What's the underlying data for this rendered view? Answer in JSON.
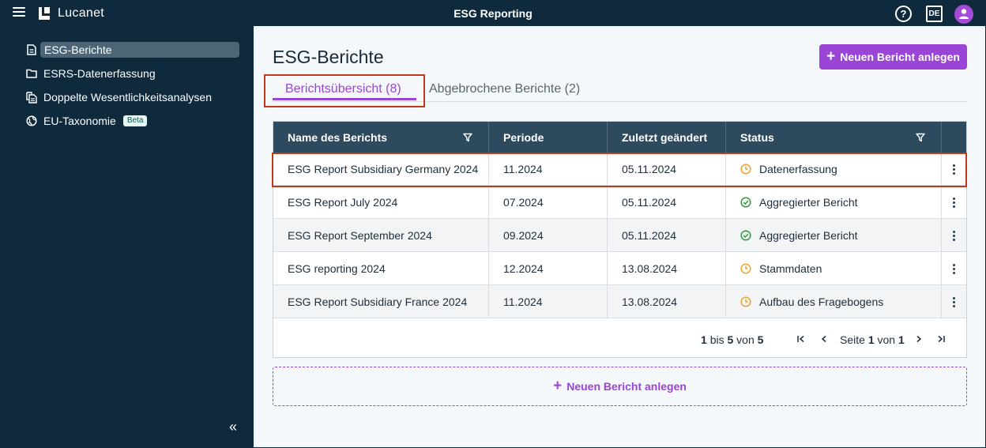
{
  "topbar": {
    "brand": "Lucanet",
    "app_title": "ESG Reporting",
    "help_label": "?",
    "language": "DE"
  },
  "sidebar": {
    "items": [
      {
        "label": "ESG-Berichte",
        "icon": "document-icon",
        "active": true
      },
      {
        "label": "ESRS-Datenerfassung",
        "icon": "folder-icon"
      },
      {
        "label": "Doppelte Wesentlichkeitsanalysen",
        "icon": "copy-document-icon"
      },
      {
        "label": "EU-Taxonomie",
        "icon": "globe-icon",
        "badge": "Beta"
      }
    ],
    "collapse_label": "«"
  },
  "main": {
    "title": "ESG-Berichte",
    "primary_button": "Neuen Bericht anlegen",
    "tabs": [
      {
        "label": "Berichtsübersicht (8)",
        "active": true
      },
      {
        "label": "Abgebrochene Berichte (2)"
      }
    ],
    "table": {
      "columns": [
        "Name des Berichts",
        "Periode",
        "Zuletzt geändert",
        "Status"
      ],
      "rows": [
        {
          "name": "ESG Report Subsidiary Germany 2024",
          "period": "11.2024",
          "modified": "05.11.2024",
          "status": "Datenerfassung",
          "status_icon": "clock-icon"
        },
        {
          "name": "ESG Report July 2024",
          "period": "07.2024",
          "modified": "05.11.2024",
          "status": "Aggregierter Bericht",
          "status_icon": "check-circle-icon"
        },
        {
          "name": "ESG Report September 2024",
          "period": "09.2024",
          "modified": "05.11.2024",
          "status": "Aggregierter Bericht",
          "status_icon": "check-circle-icon"
        },
        {
          "name": "ESG reporting 2024",
          "period": "12.2024",
          "modified": "13.08.2024",
          "status": "Stammdaten",
          "status_icon": "clock-icon"
        },
        {
          "name": "ESG Report Subsidiary France 2024",
          "period": "11.2024",
          "modified": "13.08.2024",
          "status": "Aufbau des Fragebogens",
          "status_icon": "clock-icon"
        }
      ]
    },
    "pagination": {
      "from": "1",
      "bis": "bis",
      "to": "5",
      "von": "von",
      "total": "5",
      "page_word": "Seite",
      "page": "1",
      "of_word": "von",
      "page_total": "1"
    },
    "add_box_label": "Neuen Bericht anlegen"
  },
  "colors": {
    "accent": "#9b45d6",
    "navy": "#0f2a3d",
    "table_header": "#2e4a5e",
    "status_pending": "#f0a030",
    "status_done": "#2e9a3c",
    "highlight": "#c0391b"
  }
}
